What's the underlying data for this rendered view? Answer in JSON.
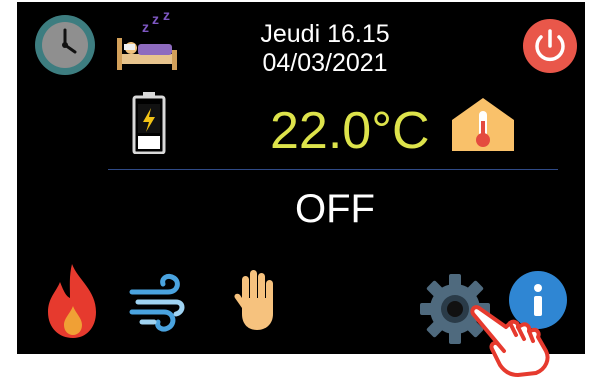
{
  "header": {
    "day_time": "Jeudi 16.15",
    "date": "04/03/2021"
  },
  "status": {
    "temperature": "22.0°C",
    "mode": "OFF"
  },
  "icons": {
    "clock": "clock-icon",
    "sleep": "sleep-icon",
    "power": "power-icon",
    "battery": "battery-charging-icon",
    "home_temp": "home-thermometer-icon",
    "heat": "flame-icon",
    "wind": "wind-icon",
    "stop": "hand-stop-icon",
    "settings": "gear-icon",
    "info": "info-icon",
    "pointer": "pointing-hand-icon"
  },
  "colors": {
    "background": "#000000",
    "temperature": "#dde34b",
    "power": "#e9574a",
    "info": "#2f86d3",
    "gear": "#4f6a7e",
    "divider": "#2f4a86"
  }
}
